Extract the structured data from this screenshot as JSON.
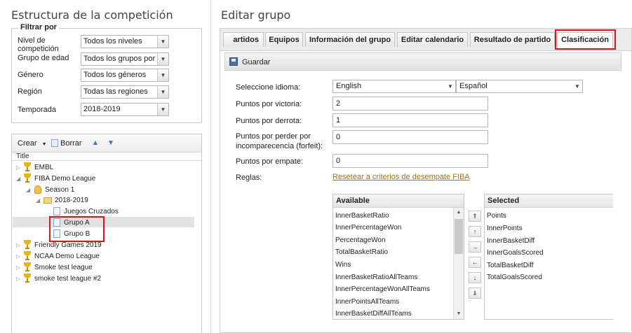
{
  "left": {
    "title": "Estructura de la competición",
    "filter": {
      "legend": "Filtrar por",
      "rows": [
        {
          "label": "Nivel de competición",
          "value": "Todos los niveles"
        },
        {
          "label": "Grupo de edad",
          "value": "Todos los grupos por"
        },
        {
          "label": "Género",
          "value": "Todos los géneros"
        },
        {
          "label": "Región",
          "value": "Todas las regiones"
        },
        {
          "label": "Temporada",
          "value": "2018-2019"
        }
      ]
    },
    "toolbar": {
      "create": "Crear",
      "delete": "Borrar"
    },
    "tree_header": "Title",
    "tree": {
      "embl": "EMBL",
      "fiba": "FIBA Demo League",
      "season": "Season 1",
      "year": "2018-2019",
      "juegos": "Juegos Cruzados",
      "grupo_a": "Grupo A",
      "grupo_b": "Grupo B",
      "friendly": "Friendly Games 2019",
      "ncaa": "NCAA Demo League",
      "smoke": "Smoke test league",
      "smoke2": "smoke test league #2"
    }
  },
  "right": {
    "title": "Editar grupo",
    "tabs": [
      "artidos",
      "Equipos",
      "Información del grupo",
      "Editar calendario",
      "Resultado de partido",
      "Clasificación"
    ],
    "save_label": "Guardar",
    "form": {
      "language_label": "Seleccione idioma:",
      "language_1": "English",
      "language_2": "Español",
      "win_label": "Puntos por victoria:",
      "win_value": "2",
      "loss_label": "Puntos por derrota:",
      "loss_value": "1",
      "forfeit_label": "Puntos por perder por incomparecencia (forfeit):",
      "forfeit_value": "0",
      "draw_label": "Puntos por empate:",
      "draw_value": "0",
      "rules_label": "Reglas:",
      "reset_link": "Resetear a criterios de desempate FIBA"
    },
    "available": {
      "header": "Available",
      "items": [
        "InnerBasketRatio",
        "InnerPercentageWon",
        "PercentageWon",
        "TotalBasketRatio",
        "Wins",
        "InnerBasketRatioAllTeams",
        "InnerPercentageWonAllTeams",
        "InnerPointsAllTeams",
        "InnerBasketDiffAllTeams"
      ]
    },
    "selected": {
      "header": "Selected",
      "items": [
        "Points",
        "InnerPoints",
        "InnerBasketDiff",
        "InnerGoalsScored",
        "TotalBasketDiff",
        "TotalGoalsScored"
      ]
    }
  }
}
